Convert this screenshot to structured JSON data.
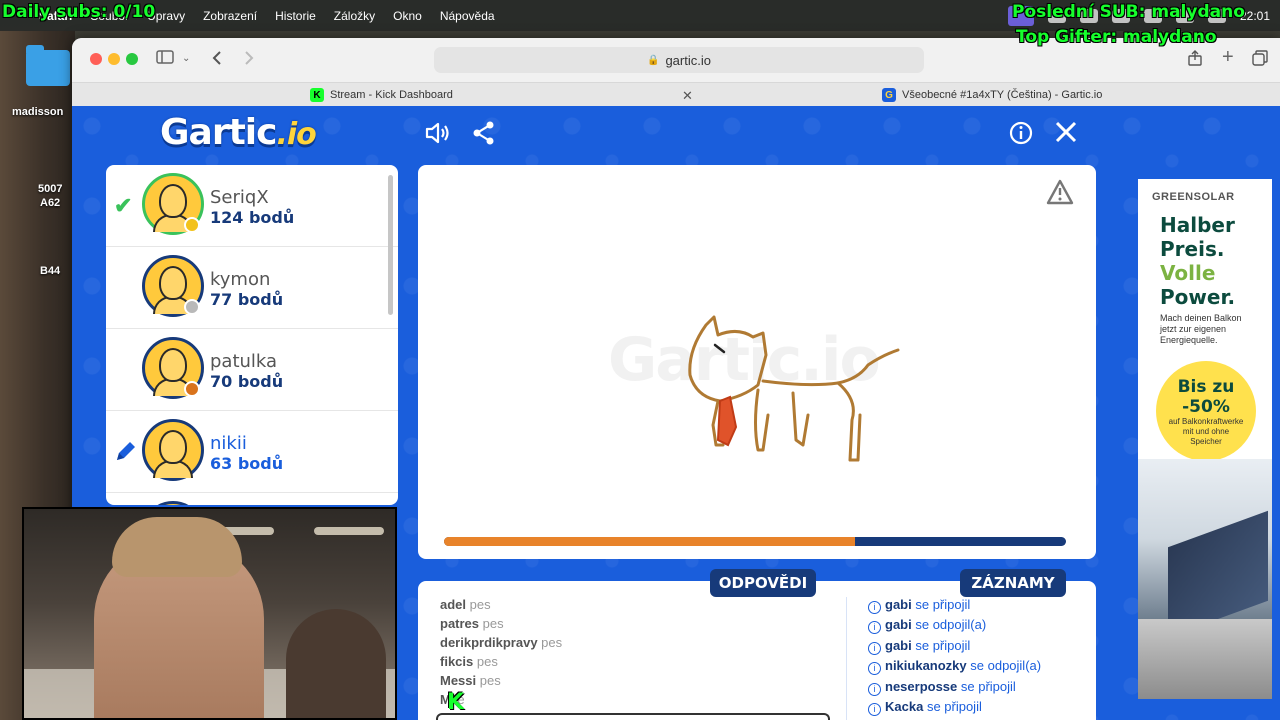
{
  "overlay": {
    "daily_subs": "Daily subs: 0/10",
    "last_sub": "Poslední SUB: malydano",
    "top_gifter": "Top Gifter: malydano"
  },
  "menubar": {
    "items": [
      "Safari",
      "Soubor",
      "Úpravy",
      "Zobrazení",
      "Historie",
      "Záložky",
      "Okno",
      "Nápověda"
    ],
    "clock": "22:01"
  },
  "desktop": {
    "labels": [
      "madisson",
      "5007",
      "A62",
      "B44"
    ]
  },
  "browser": {
    "url": "gartic.io",
    "tabs": [
      {
        "title": "Stream - Kick Dashboard",
        "icon": "K"
      },
      {
        "title": "Všeobecné #1a4xTY (Čeština) - Gartic.io",
        "icon": "G"
      }
    ]
  },
  "gartic": {
    "logo_main": "Gartic",
    "logo_suffix": ".io",
    "players": [
      {
        "name": "SeriqX",
        "points": "124 bodů",
        "status": "guessed",
        "medal_color": "#f2c21b"
      },
      {
        "name": "kymon",
        "points": "77 bodů",
        "status": "",
        "medal_color": "#b9b9b9"
      },
      {
        "name": "patulka",
        "points": "70 bodů",
        "status": "",
        "medal_color": "#d9731c"
      },
      {
        "name": "nikii",
        "points": "63 bodů",
        "status": "drawing",
        "medal_color": ""
      }
    ],
    "watermark": "Gartic.io",
    "timer_progress": 0.66,
    "answers_title": "ODPOVĚDI",
    "logs_title": "ZÁZNAMY",
    "answers": [
      {
        "user": "adel",
        "text": "pes"
      },
      {
        "user": "patres",
        "text": "pes"
      },
      {
        "user": "derikprdikpravy",
        "text": "pes"
      },
      {
        "user": "fikcis",
        "text": "pes"
      },
      {
        "user": "Messi",
        "text": "pes"
      },
      {
        "user": "M",
        "text": "le"
      }
    ],
    "logs": [
      {
        "user": "gabi",
        "text": "se připojil"
      },
      {
        "user": "gabi",
        "text": "se odpojil(a)"
      },
      {
        "user": "gabi",
        "text": "se připojil"
      },
      {
        "user": "nikiukanozky",
        "text": "se odpojil(a)"
      },
      {
        "user": "neserposse",
        "text": "se připojil"
      },
      {
        "user": "Kacka",
        "text": "se připojil"
      }
    ]
  },
  "ad": {
    "brand": "GREENSOLAR",
    "headline1": "Halber",
    "headline2": "Preis.",
    "headline3": "Volle",
    "headline4": "Power.",
    "subtext": "Mach deinen Balkon jetzt zur eigenen Energiequelle.",
    "badge_main": "Bis zu -50%",
    "badge_sub": "auf Balkonkraftwerke mit und ohne Speicher"
  },
  "colors": {
    "gartic_blue": "#1a5edc",
    "navy": "#173a7a",
    "timer_orange": "#e8832a",
    "overlay_green": "#16ff2c"
  }
}
